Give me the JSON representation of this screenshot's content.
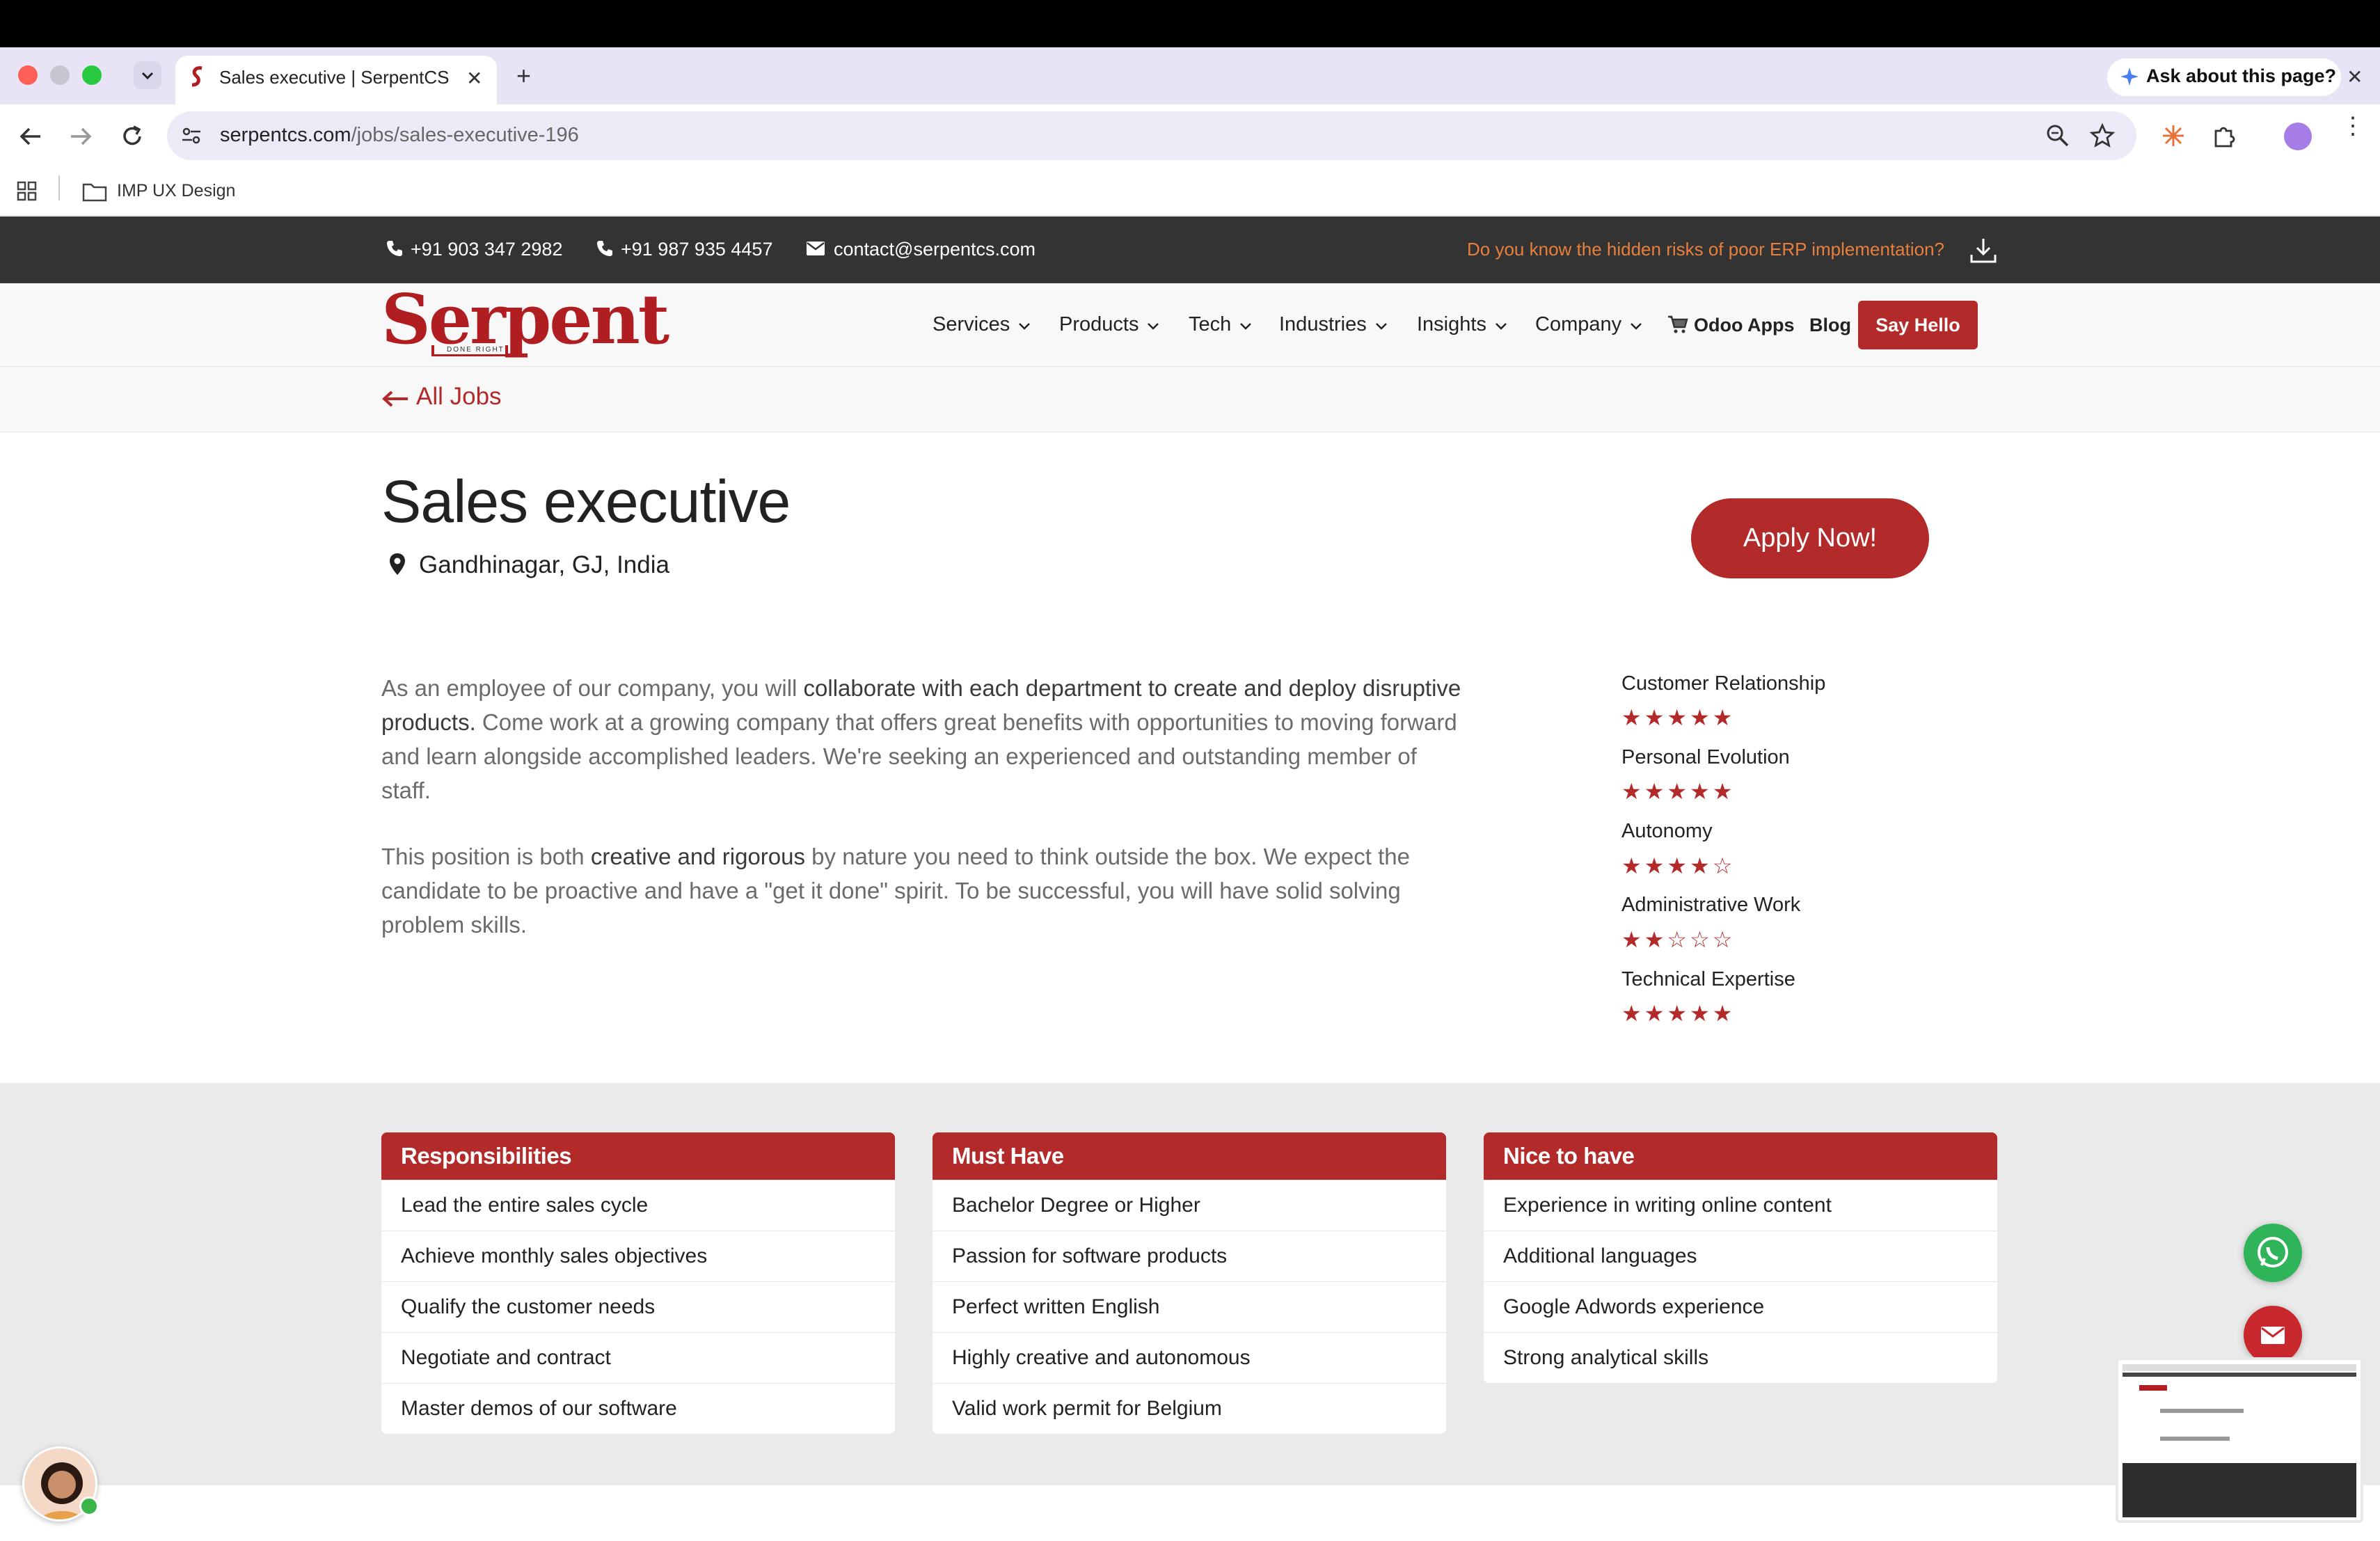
{
  "browser": {
    "tab_title": "Sales executive | SerpentCS",
    "new_tab_label": "+",
    "ask_label": "Ask about this page?",
    "url_host": "serpentcs.com",
    "url_path": "/jobs/sales-executive-196",
    "bookmark_folder": "IMP UX Design"
  },
  "topbar": {
    "phone1": "+91 903 347 2982",
    "phone2": "+91 987 935 4457",
    "email": "contact@serpentcs.com",
    "erp_risk": "Do you know the hidden risks of poor ERP implementation?"
  },
  "logo": {
    "text": "Serpent",
    "tagline": "DONE RIGHT"
  },
  "nav": {
    "services": "Services",
    "products": "Products",
    "tech": "Tech",
    "industries": "Industries",
    "insights": "Insights",
    "company": "Company",
    "odoo_apps": "Odoo Apps",
    "blog": "Blog",
    "say_hello": "Say Hello"
  },
  "back_link": "All Jobs",
  "job": {
    "title": "Sales executive",
    "location": "Gandhinagar, GJ, India",
    "apply": "Apply Now!"
  },
  "description": {
    "p1_a": "As an employee of our company, you will ",
    "p1_b": "collaborate with each department to create and deploy disruptive products.",
    "p1_c": " Come work at a growing company that offers great benefits with opportunities to moving forward and learn alongside accomplished leaders. We're seeking an experienced and outstanding member of staff.",
    "p2_a": "This position is both ",
    "p2_b": "creative and rigorous",
    "p2_c": " by nature you need to think outside the box. We expect the candidate to be proactive and have a \"get it done\" spirit. To be successful, you will have solid solving problem skills."
  },
  "ratings": [
    {
      "label": "Customer Relationship",
      "stars": 5,
      "out_of": 5
    },
    {
      "label": "Personal Evolution",
      "stars": 5,
      "out_of": 5
    },
    {
      "label": "Autonomy",
      "stars": 4,
      "out_of": 5
    },
    {
      "label": "Administrative Work",
      "stars": 2,
      "out_of": 5
    },
    {
      "label": "Technical Expertise",
      "stars": 5,
      "out_of": 5
    }
  ],
  "lists": {
    "responsibilities": {
      "title": "Responsibilities",
      "items": [
        "Lead the entire sales cycle",
        "Achieve monthly sales objectives",
        "Qualify the customer needs",
        "Negotiate and contract",
        "Master demos of our software"
      ]
    },
    "must_have": {
      "title": "Must Have",
      "items": [
        "Bachelor Degree or Higher",
        "Passion for software products",
        "Perfect written English",
        "Highly creative and autonomous",
        "Valid work permit for Belgium"
      ]
    },
    "nice_to_have": {
      "title": "Nice to have",
      "items": [
        "Experience in writing online content",
        "Additional languages",
        "Google Adwords experience",
        "Strong analytical skills"
      ]
    }
  },
  "colors": {
    "brand_red": "#b22a2a",
    "topbar_bg": "#333333",
    "risk_orange": "#e87f3d",
    "whatsapp_green": "#2fb45a"
  },
  "icons": [
    "phone-icon",
    "mail-icon",
    "download-icon",
    "location-pin-icon",
    "arrow-left-icon",
    "cart-icon",
    "star-icon",
    "whatsapp-icon",
    "envelope-icon"
  ]
}
